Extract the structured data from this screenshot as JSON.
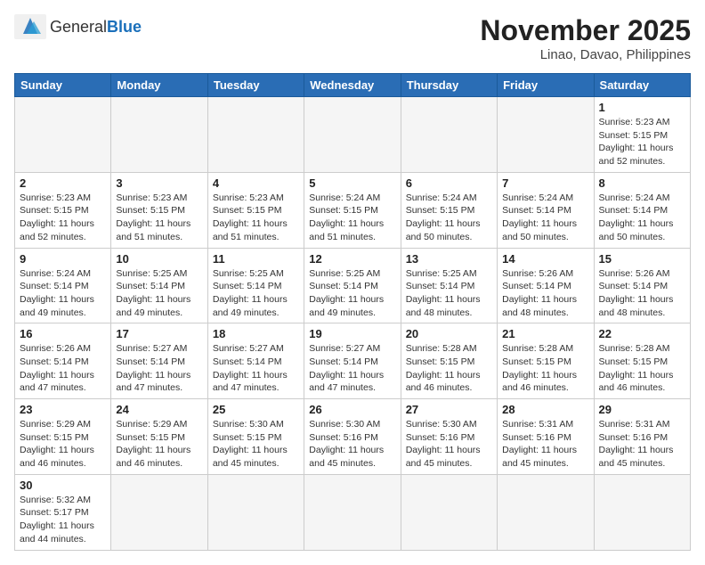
{
  "header": {
    "logo_general": "General",
    "logo_blue": "Blue",
    "month_title": "November 2025",
    "location": "Linao, Davao, Philippines"
  },
  "days_of_week": [
    "Sunday",
    "Monday",
    "Tuesday",
    "Wednesday",
    "Thursday",
    "Friday",
    "Saturday"
  ],
  "weeks": [
    [
      {
        "day": "",
        "info": ""
      },
      {
        "day": "",
        "info": ""
      },
      {
        "day": "",
        "info": ""
      },
      {
        "day": "",
        "info": ""
      },
      {
        "day": "",
        "info": ""
      },
      {
        "day": "",
        "info": ""
      },
      {
        "day": "1",
        "info": "Sunrise: 5:23 AM\nSunset: 5:15 PM\nDaylight: 11 hours\nand 52 minutes."
      }
    ],
    [
      {
        "day": "2",
        "info": "Sunrise: 5:23 AM\nSunset: 5:15 PM\nDaylight: 11 hours\nand 52 minutes."
      },
      {
        "day": "3",
        "info": "Sunrise: 5:23 AM\nSunset: 5:15 PM\nDaylight: 11 hours\nand 51 minutes."
      },
      {
        "day": "4",
        "info": "Sunrise: 5:23 AM\nSunset: 5:15 PM\nDaylight: 11 hours\nand 51 minutes."
      },
      {
        "day": "5",
        "info": "Sunrise: 5:24 AM\nSunset: 5:15 PM\nDaylight: 11 hours\nand 51 minutes."
      },
      {
        "day": "6",
        "info": "Sunrise: 5:24 AM\nSunset: 5:15 PM\nDaylight: 11 hours\nand 50 minutes."
      },
      {
        "day": "7",
        "info": "Sunrise: 5:24 AM\nSunset: 5:14 PM\nDaylight: 11 hours\nand 50 minutes."
      },
      {
        "day": "8",
        "info": "Sunrise: 5:24 AM\nSunset: 5:14 PM\nDaylight: 11 hours\nand 50 minutes."
      }
    ],
    [
      {
        "day": "9",
        "info": "Sunrise: 5:24 AM\nSunset: 5:14 PM\nDaylight: 11 hours\nand 49 minutes."
      },
      {
        "day": "10",
        "info": "Sunrise: 5:25 AM\nSunset: 5:14 PM\nDaylight: 11 hours\nand 49 minutes."
      },
      {
        "day": "11",
        "info": "Sunrise: 5:25 AM\nSunset: 5:14 PM\nDaylight: 11 hours\nand 49 minutes."
      },
      {
        "day": "12",
        "info": "Sunrise: 5:25 AM\nSunset: 5:14 PM\nDaylight: 11 hours\nand 49 minutes."
      },
      {
        "day": "13",
        "info": "Sunrise: 5:25 AM\nSunset: 5:14 PM\nDaylight: 11 hours\nand 48 minutes."
      },
      {
        "day": "14",
        "info": "Sunrise: 5:26 AM\nSunset: 5:14 PM\nDaylight: 11 hours\nand 48 minutes."
      },
      {
        "day": "15",
        "info": "Sunrise: 5:26 AM\nSunset: 5:14 PM\nDaylight: 11 hours\nand 48 minutes."
      }
    ],
    [
      {
        "day": "16",
        "info": "Sunrise: 5:26 AM\nSunset: 5:14 PM\nDaylight: 11 hours\nand 47 minutes."
      },
      {
        "day": "17",
        "info": "Sunrise: 5:27 AM\nSunset: 5:14 PM\nDaylight: 11 hours\nand 47 minutes."
      },
      {
        "day": "18",
        "info": "Sunrise: 5:27 AM\nSunset: 5:14 PM\nDaylight: 11 hours\nand 47 minutes."
      },
      {
        "day": "19",
        "info": "Sunrise: 5:27 AM\nSunset: 5:14 PM\nDaylight: 11 hours\nand 47 minutes."
      },
      {
        "day": "20",
        "info": "Sunrise: 5:28 AM\nSunset: 5:15 PM\nDaylight: 11 hours\nand 46 minutes."
      },
      {
        "day": "21",
        "info": "Sunrise: 5:28 AM\nSunset: 5:15 PM\nDaylight: 11 hours\nand 46 minutes."
      },
      {
        "day": "22",
        "info": "Sunrise: 5:28 AM\nSunset: 5:15 PM\nDaylight: 11 hours\nand 46 minutes."
      }
    ],
    [
      {
        "day": "23",
        "info": "Sunrise: 5:29 AM\nSunset: 5:15 PM\nDaylight: 11 hours\nand 46 minutes."
      },
      {
        "day": "24",
        "info": "Sunrise: 5:29 AM\nSunset: 5:15 PM\nDaylight: 11 hours\nand 46 minutes."
      },
      {
        "day": "25",
        "info": "Sunrise: 5:30 AM\nSunset: 5:15 PM\nDaylight: 11 hours\nand 45 minutes."
      },
      {
        "day": "26",
        "info": "Sunrise: 5:30 AM\nSunset: 5:16 PM\nDaylight: 11 hours\nand 45 minutes."
      },
      {
        "day": "27",
        "info": "Sunrise: 5:30 AM\nSunset: 5:16 PM\nDaylight: 11 hours\nand 45 minutes."
      },
      {
        "day": "28",
        "info": "Sunrise: 5:31 AM\nSunset: 5:16 PM\nDaylight: 11 hours\nand 45 minutes."
      },
      {
        "day": "29",
        "info": "Sunrise: 5:31 AM\nSunset: 5:16 PM\nDaylight: 11 hours\nand 45 minutes."
      }
    ],
    [
      {
        "day": "30",
        "info": "Sunrise: 5:32 AM\nSunset: 5:17 PM\nDaylight: 11 hours\nand 44 minutes."
      },
      {
        "day": "",
        "info": ""
      },
      {
        "day": "",
        "info": ""
      },
      {
        "day": "",
        "info": ""
      },
      {
        "day": "",
        "info": ""
      },
      {
        "day": "",
        "info": ""
      },
      {
        "day": "",
        "info": ""
      }
    ]
  ]
}
